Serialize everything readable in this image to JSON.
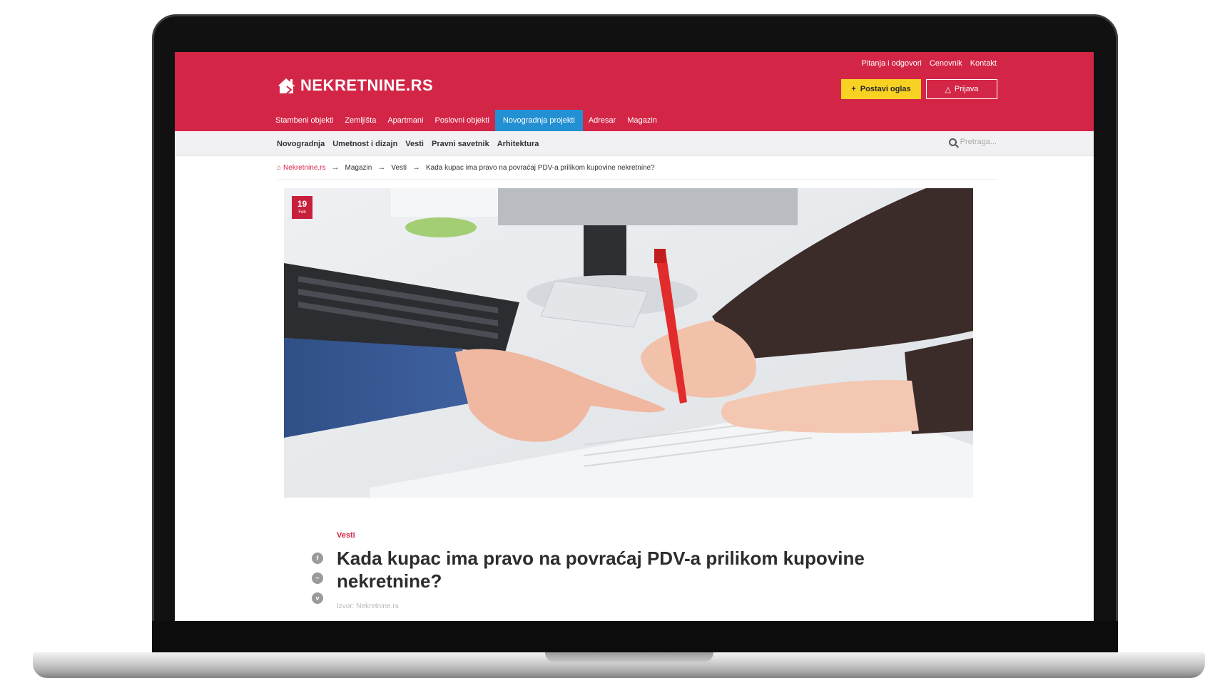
{
  "site": {
    "logo_text": "NEKRETNINE.RS",
    "top_links": [
      "Pitanja i odgovori",
      "Cenovnik",
      "Kontakt"
    ],
    "post_button_label": "Postavi oglas",
    "login_button_label": "Prijava"
  },
  "main_nav": [
    {
      "label": "Stambeni objekti",
      "active": false
    },
    {
      "label": "Zemljišta",
      "active": false
    },
    {
      "label": "Apartmani",
      "active": false
    },
    {
      "label": "Poslovni objekti",
      "active": false
    },
    {
      "label": "Novogradnja projekti",
      "active": true
    },
    {
      "label": "Adresar",
      "active": false
    },
    {
      "label": "Magazin",
      "active": false
    }
  ],
  "sub_nav": [
    "Novogradnja",
    "Umetnost i dizajn",
    "Vesti",
    "Pravni savetnik",
    "Arhitektura"
  ],
  "search": {
    "placeholder": "Pretraga..."
  },
  "breadcrumb": [
    "Nekretnine.rs",
    "Magazin",
    "Vesti",
    "Kada kupac ima pravo na povraćaj PDV-a prilikom kupovine nekretnine?"
  ],
  "article": {
    "date_day": "19",
    "date_month": "Feb",
    "category": "Vesti",
    "title": "Kada kupac ima pravo na povraćaj PDV-a prilikom kupovine nekretnine?",
    "source": "Izvor: Nekretnine.rs",
    "share_icons": [
      "facebook-icon",
      "messenger-icon",
      "viber-icon"
    ]
  },
  "colors": {
    "brand": "#d32647",
    "active_nav": "#2290d2",
    "post_button": "#f8d223"
  }
}
